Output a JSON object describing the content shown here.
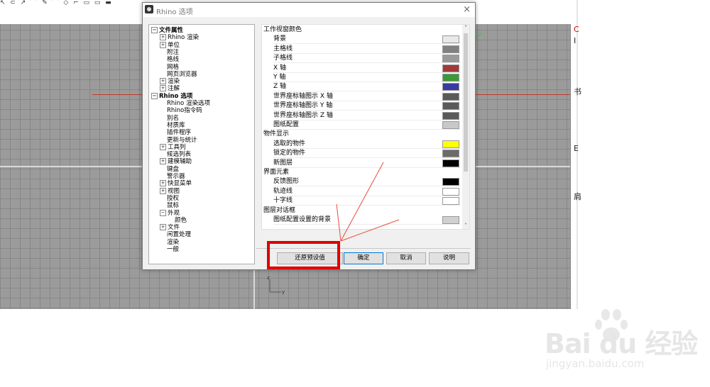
{
  "dialog": {
    "title": "Rhino 选项",
    "close_glyph": "×"
  },
  "tree": [
    {
      "label": "文件属性",
      "level": 0,
      "expander": "−",
      "bold": true
    },
    {
      "label": "Rhino 渲染",
      "level": 1,
      "expander": "+"
    },
    {
      "label": "单位",
      "level": 1,
      "expander": "+"
    },
    {
      "label": "附注",
      "level": 1
    },
    {
      "label": "格线",
      "level": 1
    },
    {
      "label": "网格",
      "level": 1
    },
    {
      "label": "网页浏览器",
      "level": 1
    },
    {
      "label": "渲染",
      "level": 1,
      "expander": "+"
    },
    {
      "label": "注解",
      "level": 1,
      "expander": "+"
    },
    {
      "label": "Rhino 选项",
      "level": 0,
      "expander": "−",
      "bold": true
    },
    {
      "label": "Rhino 渲染选项",
      "level": 1
    },
    {
      "label": "Rhino指令码",
      "level": 1
    },
    {
      "label": "别名",
      "level": 1
    },
    {
      "label": "材质库",
      "level": 1
    },
    {
      "label": "插件程序",
      "level": 1
    },
    {
      "label": "更新与统计",
      "level": 1
    },
    {
      "label": "工具列",
      "level": 1,
      "expander": "+"
    },
    {
      "label": "候选列表",
      "level": 1
    },
    {
      "label": "建模辅助",
      "level": 1,
      "expander": "+"
    },
    {
      "label": "键盘",
      "level": 1
    },
    {
      "label": "警示器",
      "level": 1
    },
    {
      "label": "快显菜单",
      "level": 1,
      "expander": "+"
    },
    {
      "label": "视图",
      "level": 1,
      "expander": "+"
    },
    {
      "label": "授权",
      "level": 1
    },
    {
      "label": "鼠标",
      "level": 1
    },
    {
      "label": "外观",
      "level": 1,
      "expander": "−"
    },
    {
      "label": "颜色",
      "level": 2
    },
    {
      "label": "文件",
      "level": 1,
      "expander": "+"
    },
    {
      "label": "闲置处理",
      "level": 1
    },
    {
      "label": "渲染",
      "level": 1
    },
    {
      "label": "一般",
      "level": 1
    }
  ],
  "settings": [
    {
      "type": "section",
      "label": "工作视窗颜色"
    },
    {
      "type": "item",
      "label": "背景",
      "color": "#e8e8e8"
    },
    {
      "type": "item",
      "label": "主格线",
      "color": "#808080"
    },
    {
      "type": "item",
      "label": "子格线",
      "color": "#9a9a9a"
    },
    {
      "type": "item",
      "label": "X 轴",
      "color": "#a33a3a"
    },
    {
      "type": "item",
      "label": "Y 轴",
      "color": "#3a9a3a"
    },
    {
      "type": "item",
      "label": "Z 轴",
      "color": "#3a3aa3"
    },
    {
      "type": "item",
      "label": "世界座标轴图示 X 轴",
      "color": "#5a5a5a"
    },
    {
      "type": "item",
      "label": "世界座标轴图示 Y 轴",
      "color": "#5a5a5a"
    },
    {
      "type": "item",
      "label": "世界座标轴图示 Z 轴",
      "color": "#5a5a5a"
    },
    {
      "type": "item",
      "label": "图纸配置",
      "color": "#c8c8c8"
    },
    {
      "type": "section",
      "label": "物件显示"
    },
    {
      "type": "item",
      "label": "选取的物件",
      "color": "#ffff00"
    },
    {
      "type": "item",
      "label": "锁定的物件",
      "color": "#6a6a6a"
    },
    {
      "type": "item",
      "label": "新图层",
      "color": "#000000"
    },
    {
      "type": "section",
      "label": "界面元素"
    },
    {
      "type": "item",
      "label": "反馈图形",
      "color": "#000000"
    },
    {
      "type": "item",
      "label": "轨迹线",
      "color": "#ffffff"
    },
    {
      "type": "item",
      "label": "十字线",
      "color": "#ffffff"
    },
    {
      "type": "section",
      "label": "图层对话框"
    },
    {
      "type": "item",
      "label": "图纸配置设置的背景",
      "color": "#d0d0d0"
    }
  ],
  "scroll": {
    "up": "˄",
    "down": "˅"
  },
  "buttons": {
    "restore": "还原预设值",
    "ok": "确定",
    "cancel": "取消",
    "help": "说明"
  },
  "viewport": {
    "axis_z": "z",
    "axis_y": "y",
    "toolbar_glyphs": "↖ ⊂ ↗ ⌒ ✎ ⌒ ◇ ⌐ ▭ ▭ ▬"
  },
  "right_panel": [
    "C",
    "I",
    "书",
    "E",
    "肩"
  ],
  "watermark": {
    "brand": "Bai du 经验",
    "url": "jingyan.baidu.com"
  },
  "colors": {
    "highlight": "#e00000",
    "x_axis": "#c0392b",
    "y_axis": "#2ecc40"
  }
}
